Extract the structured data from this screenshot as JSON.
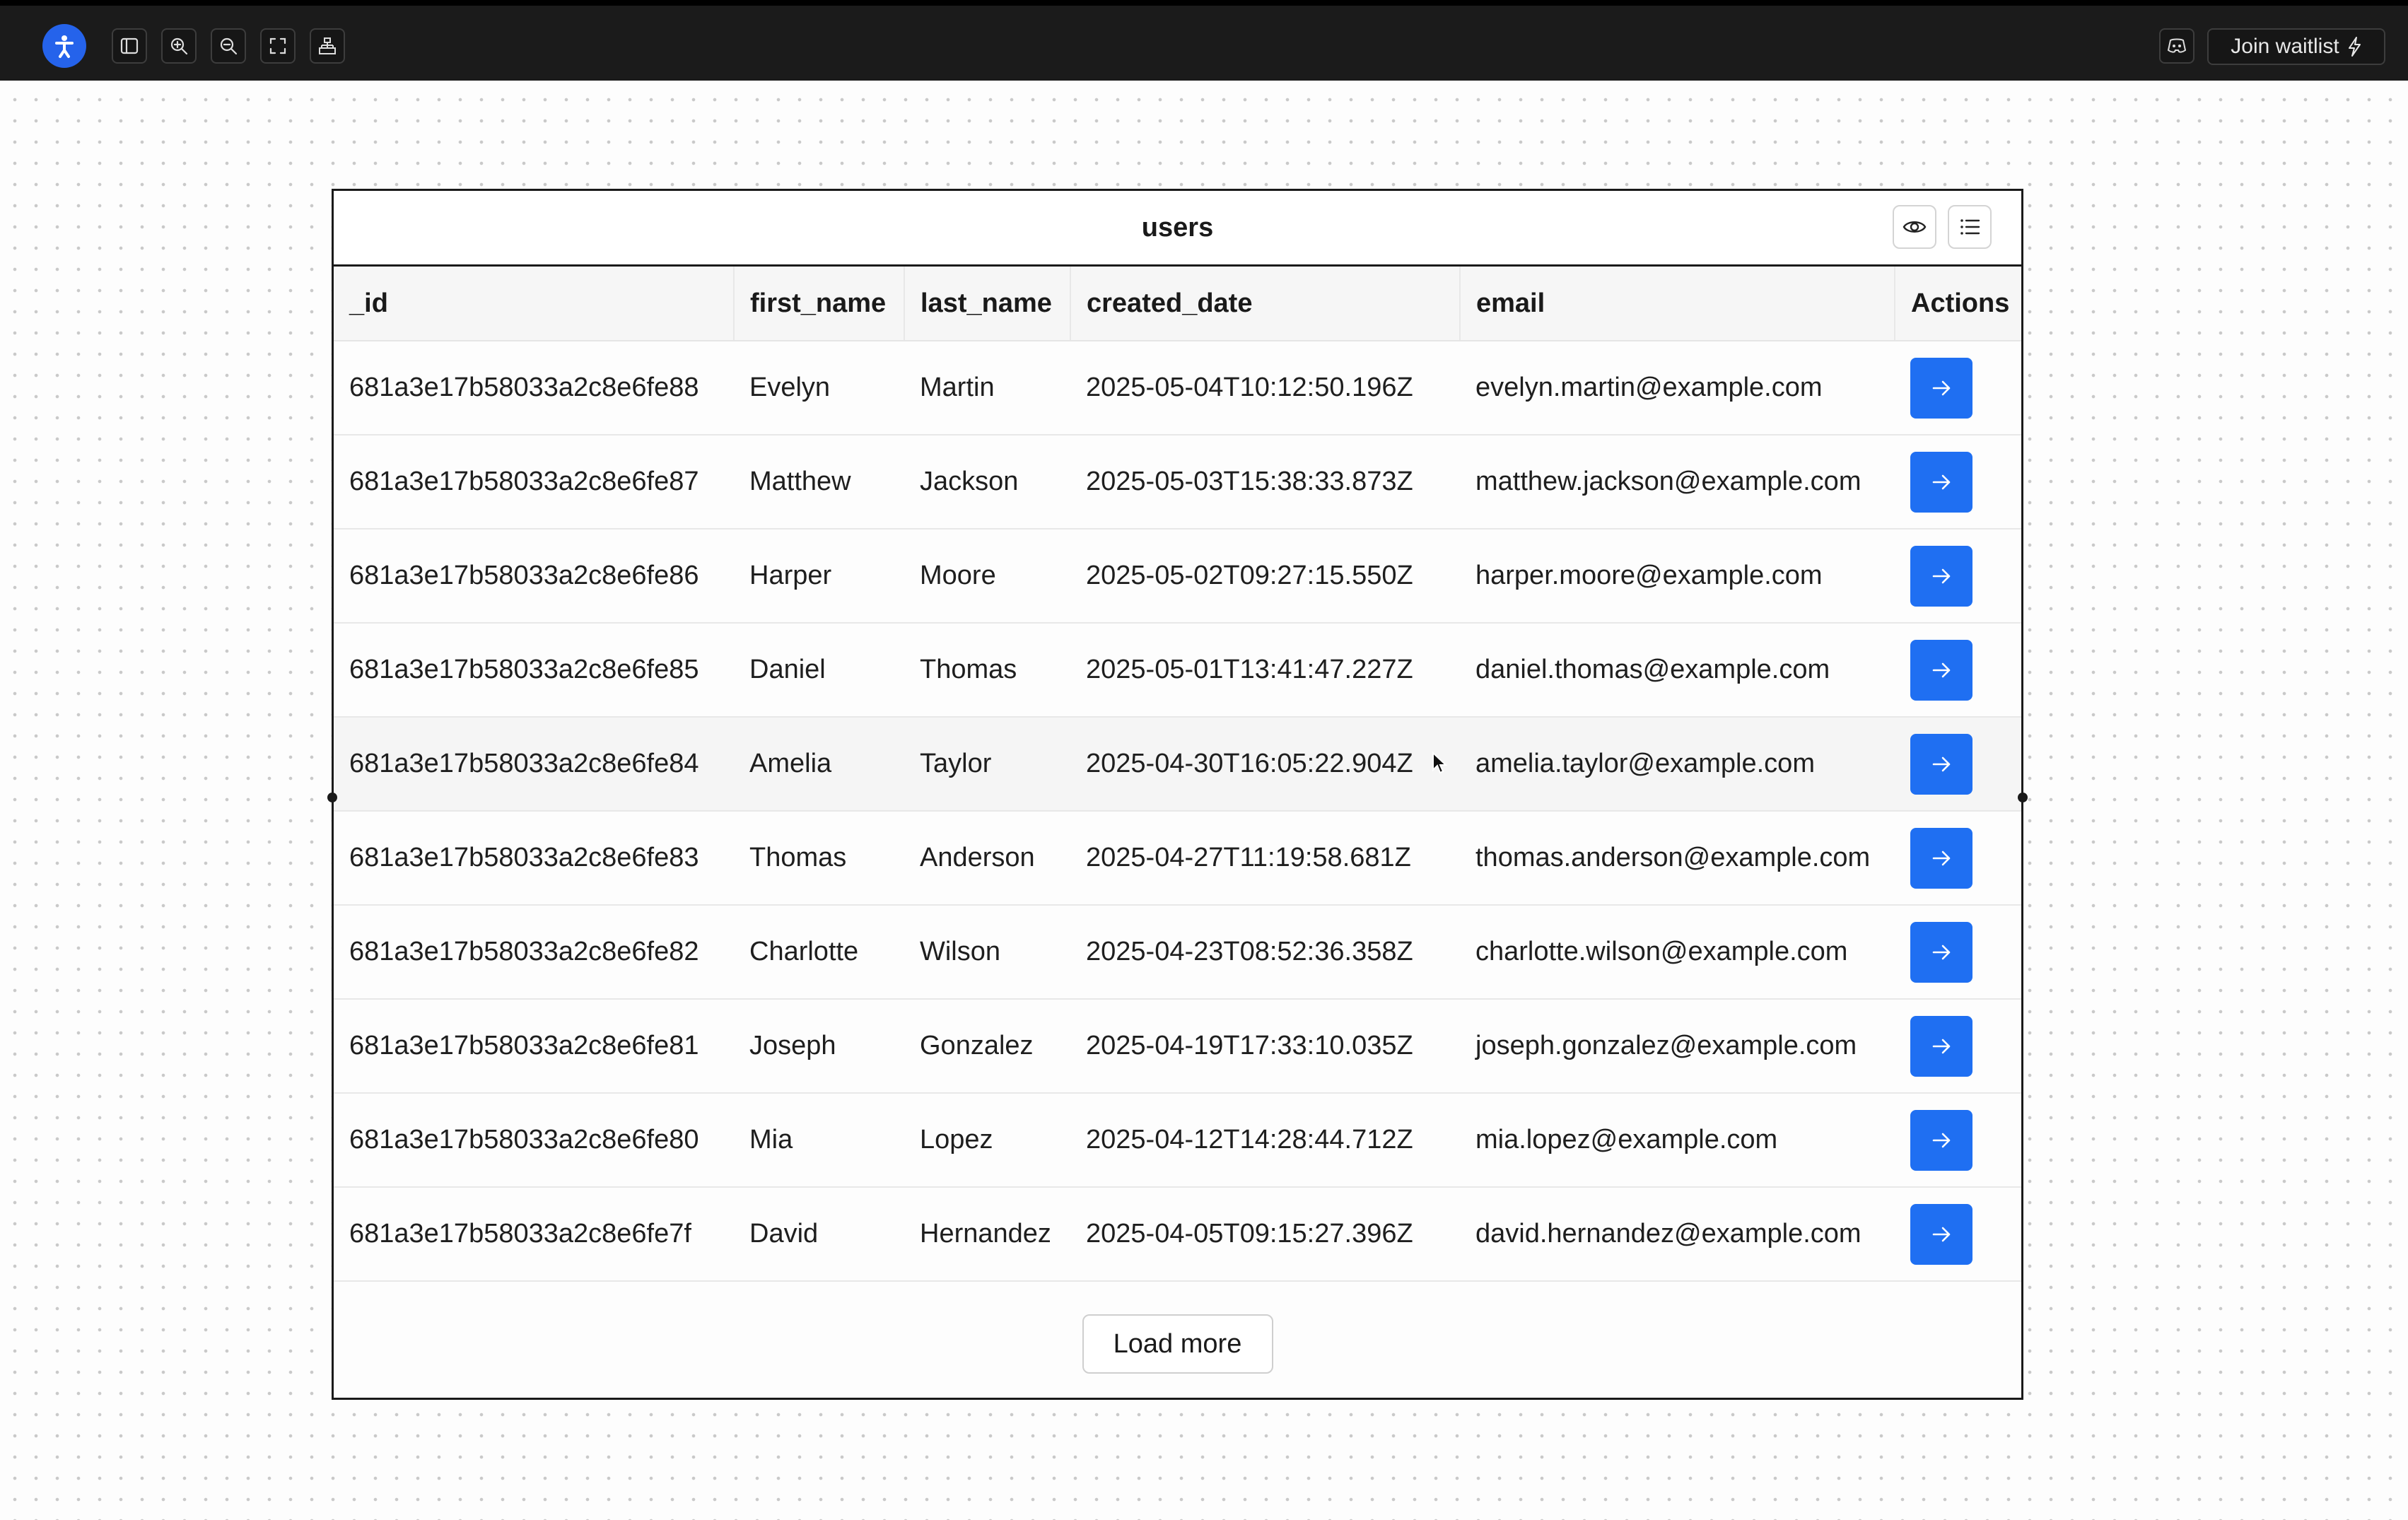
{
  "toolbar": {
    "icons": [
      "sidebar-toggle-icon",
      "zoom-in-icon",
      "zoom-out-icon",
      "fullscreen-icon",
      "hierarchy-icon"
    ],
    "join_label": "Join waitlist"
  },
  "table": {
    "title": "users",
    "columns": [
      "_id",
      "first_name",
      "last_name",
      "created_date",
      "email",
      "Actions"
    ],
    "rows": [
      [
        "681a3e17b58033a2c8e6fe88",
        "Evelyn",
        "Martin",
        "2025-05-04T10:12:50.196Z",
        "evelyn.martin@example.com"
      ],
      [
        "681a3e17b58033a2c8e6fe87",
        "Matthew",
        "Jackson",
        "2025-05-03T15:38:33.873Z",
        "matthew.jackson@example.com"
      ],
      [
        "681a3e17b58033a2c8e6fe86",
        "Harper",
        "Moore",
        "2025-05-02T09:27:15.550Z",
        "harper.moore@example.com"
      ],
      [
        "681a3e17b58033a2c8e6fe85",
        "Daniel",
        "Thomas",
        "2025-05-01T13:41:47.227Z",
        "daniel.thomas@example.com"
      ],
      [
        "681a3e17b58033a2c8e6fe84",
        "Amelia",
        "Taylor",
        "2025-04-30T16:05:22.904Z",
        "amelia.taylor@example.com"
      ],
      [
        "681a3e17b58033a2c8e6fe83",
        "Thomas",
        "Anderson",
        "2025-04-27T11:19:58.681Z",
        "thomas.anderson@example.com"
      ],
      [
        "681a3e17b58033a2c8e6fe82",
        "Charlotte",
        "Wilson",
        "2025-04-23T08:52:36.358Z",
        "charlotte.wilson@example.com"
      ],
      [
        "681a3e17b58033a2c8e6fe81",
        "Joseph",
        "Gonzalez",
        "2025-04-19T17:33:10.035Z",
        "joseph.gonzalez@example.com"
      ],
      [
        "681a3e17b58033a2c8e6fe80",
        "Mia",
        "Lopez",
        "2025-04-12T14:28:44.712Z",
        "mia.lopez@example.com"
      ],
      [
        "681a3e17b58033a2c8e6fe7f",
        "David",
        "Hernandez",
        "2025-04-05T09:15:27.396Z",
        "david.hernandez@example.com"
      ]
    ],
    "load_more_label": "Load more"
  },
  "colors": {
    "accent": "#1f6ff2",
    "logo": "#2563eb",
    "topbar": "#1b1b1b"
  }
}
